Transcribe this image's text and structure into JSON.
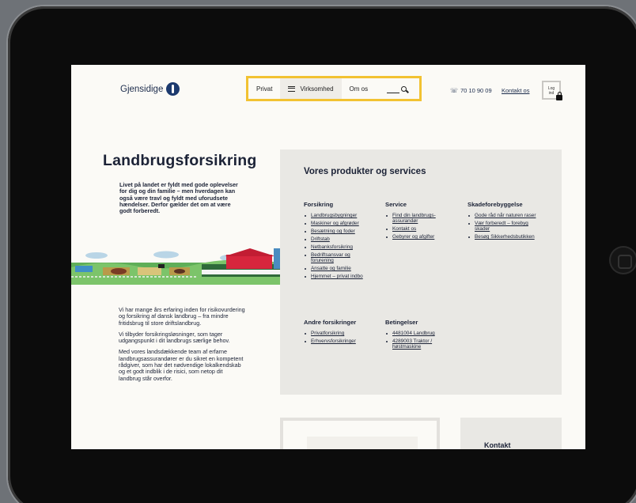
{
  "header": {
    "logo_text": "Gjensidige",
    "nav": {
      "privat": "Privat",
      "virksomhed": "Virksomhed",
      "om_os": "Om os"
    },
    "phone": "70 10 90 09",
    "contact": "Kontakt os",
    "login_line1": "Log",
    "login_line2": "ind"
  },
  "main": {
    "title": "Landbrugsforsikring",
    "intro": "Livet på landet er fyldt med gode oplevelser for dig og din familie – men hverdagen kan også være travl og fyldt med uforudsete hændelser. Derfor gælder det om at være godt forberedt.",
    "paragraphs": [
      "Vi har mange års erfaring inden for risikovurdering og forsikring af dansk landbrug – fra mindre fritidsbrug til store driftslandbrug.",
      "Vi tilbyder forsikringsløsninger, som tager udgangspunkt i dit landbrugs særlige behov.",
      "Med vores landsdækkende team af erfarne landbrugsassurandører er du sikret en kompetent rådgiver, som har det nødvendige lokalkendskab og et godt indblik i de risici, som netop dit landbrug står overfor."
    ]
  },
  "products": {
    "title": "Vores produkter og services",
    "forsikring": {
      "heading": "Forsikring",
      "items": [
        "Landbrugsbygninger",
        "Maskiner og afgrøder",
        "Besætning og foder",
        "Driftstab",
        "Netbanksforsikring",
        "Bedriftsansvar og forurening",
        "Ansatte og familie",
        "Hjemmet – privat indbo"
      ]
    },
    "service": {
      "heading": "Service",
      "items": [
        "Find din landbrugs-assurandør",
        "Kontakt os",
        "Gebyrer og afgifter"
      ]
    },
    "skade": {
      "heading": "Skadeforebyggelse",
      "items": [
        "Gode råd når naturen raser",
        "Vær forberedt – forebyg skader",
        "Besøg Sikkerhedsbutikken"
      ]
    },
    "andre": {
      "heading": "Andre forsikringer",
      "items": [
        "Privatforsikring",
        "Erhvervsforsikringer"
      ]
    },
    "betingelser": {
      "heading": "Betingelser",
      "items": [
        "4481004 Landbrug",
        "4289003 Traktor / høstmaskine"
      ]
    }
  },
  "contact_card": {
    "title": "Kontakt"
  },
  "colors": {
    "accent": "#f2c232",
    "brand": "#1c3a6e",
    "panel": "#e9e8e4"
  },
  "icons": [
    "logo-icon",
    "menu-icon",
    "search-icon",
    "phone-icon",
    "lock-icon"
  ]
}
